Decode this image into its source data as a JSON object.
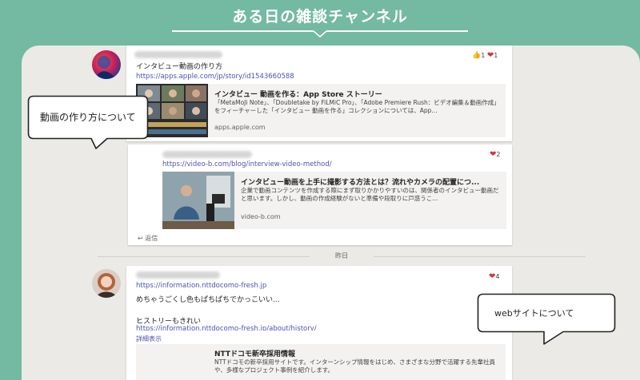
{
  "banner": {
    "title": "ある日の雑談チャンネル"
  },
  "colors": {
    "background": "#74b9a2",
    "panel": "#eceae6",
    "link": "#4f52b2",
    "heart": "#d13438"
  },
  "messages": [
    {
      "avatar": "user-avatar-1",
      "text": "インタビュー動画の作り方",
      "link": "https://apps.apple.com/jp/story/id1543660588",
      "reactions": {
        "thumb_icon": "thumbs-up-icon",
        "like_count": "1",
        "heart_icon": "heart-icon",
        "heart_count": "1"
      },
      "preview": {
        "title": "インタビュー 動画を作る：App Store ストーリー",
        "desc": "「MetaMoJi Note」、「Doubletake by FiLMiC Pro」、「Adobe Premiere Rush：ビデオ編集＆動画作成」をフィーチャーした「インタビュー 動画を作る」コレクションについては、App...",
        "domain": "apps.apple.com"
      }
    },
    {
      "avatar": "user-avatar-2",
      "link": "https://video-b.com/blog/interview-video-method/",
      "reactions": {
        "heart_icon": "heart-icon",
        "heart_count": "2"
      },
      "preview": {
        "title": "インタビュー動画を上手に撮影する方法とは？流れやカメラの配置につ...",
        "desc": "企業で動画コンテンツを作成する際にまず取りかかりやすいのは、関係者のインタビュー動画だと思います。しかし、動画の作成経験がないと準備や段取りに戸惑うこ...",
        "domain": "video-b.com"
      },
      "reply_label": "返信"
    },
    {
      "avatar": "user-avatar-3",
      "link": "https://information.nttdocomo-fresh.jp",
      "text1": "めちゃうごくし色もぱちぱちでかっこいい...",
      "text2": "ヒストリーもきれい",
      "link2": "https://information.nttdocomo-fresh.jp/about/history/",
      "more_label": "詳細表示",
      "reactions": {
        "heart_icon": "heart-icon",
        "heart_count": "4"
      },
      "preview": {
        "title": "NTTドコモ新卒採用情報",
        "desc": "NTTドコモの新卒採用サイトです。インターンシップ情報をはじめ、さまざまな分野で活躍する先輩社員や、多様なプロジェクト事例を紹介します。"
      }
    }
  ],
  "date_divider": "昨日",
  "callouts": {
    "video": "動画の作り方について",
    "web": "webサイトについて"
  }
}
